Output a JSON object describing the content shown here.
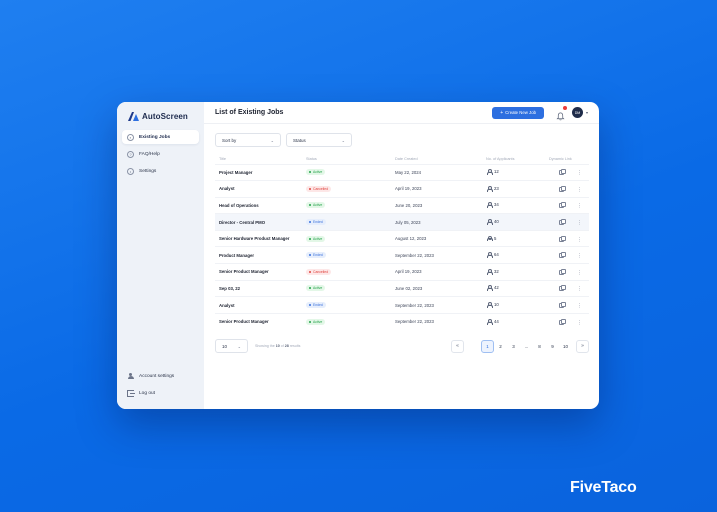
{
  "brand": {
    "name": "AutoScreen",
    "accent": "#2d6fe0"
  },
  "sidebar": {
    "items": [
      {
        "label": "Existing Jobs",
        "icon": "briefcase-icon",
        "active": true
      },
      {
        "label": "FAQ/Help",
        "icon": "help-icon",
        "active": false
      },
      {
        "label": "Settings",
        "icon": "gear-icon",
        "active": false
      }
    ],
    "bottom": [
      {
        "label": "Account settings",
        "icon": "user-icon"
      },
      {
        "label": "Log out",
        "icon": "logout-icon"
      }
    ]
  },
  "header": {
    "title": "List of Existing Jobs",
    "create_label": "Create New Job",
    "create_icon": "+",
    "avatar_initials": "DM"
  },
  "filters": {
    "sort_label": "Sort by",
    "status_label": "Status"
  },
  "table": {
    "columns": [
      "Title",
      "Status",
      "Date Created",
      "No. of Applicants",
      "Dynamic Link"
    ],
    "rows": [
      {
        "title": "Project Manager",
        "status": "Active",
        "status_type": "active",
        "date": "May 22, 2024",
        "applicants": "12"
      },
      {
        "title": "Analyst",
        "status": "Cancelled",
        "status_type": "cancel",
        "date": "April 19, 2023",
        "applicants": "23"
      },
      {
        "title": "Head of Operations",
        "status": "Active",
        "status_type": "active",
        "date": "June 20, 2023",
        "applicants": "34"
      },
      {
        "title": "Director - Central PMO",
        "status": "Ended",
        "status_type": "ended",
        "date": "July 05, 2023",
        "applicants": "40"
      },
      {
        "title": "Senior Hardware Product Manager",
        "status": "Active",
        "status_type": "active",
        "date": "August 12, 2023",
        "applicants": "5"
      },
      {
        "title": "Product Manager",
        "status": "Ended",
        "status_type": "ended",
        "date": "September 22, 2023",
        "applicants": "64"
      },
      {
        "title": "Senior Product Manager",
        "status": "Cancelled",
        "status_type": "cancel",
        "date": "April 19, 2023",
        "applicants": "32"
      },
      {
        "title": "Sep 03, 22",
        "status": "Active",
        "status_type": "active",
        "date": "June 02, 2023",
        "applicants": "42"
      },
      {
        "title": "Analyst",
        "status": "Ended",
        "status_type": "ended",
        "date": "September 22, 2023",
        "applicants": "10"
      },
      {
        "title": "Senior Product Manager",
        "status": "Active",
        "status_type": "active",
        "date": "September 22, 2023",
        "applicants": "44"
      }
    ]
  },
  "pagination": {
    "per_page": "10",
    "showing_prefix": "Showing the",
    "showing_count": "10",
    "showing_of": "of",
    "showing_total": "28",
    "showing_suffix": "results",
    "prev": "«",
    "next": "»",
    "pages": [
      "1",
      "2",
      "3",
      "...",
      "8",
      "9",
      "10"
    ],
    "current": "1"
  },
  "watermark": "FiveTaco"
}
